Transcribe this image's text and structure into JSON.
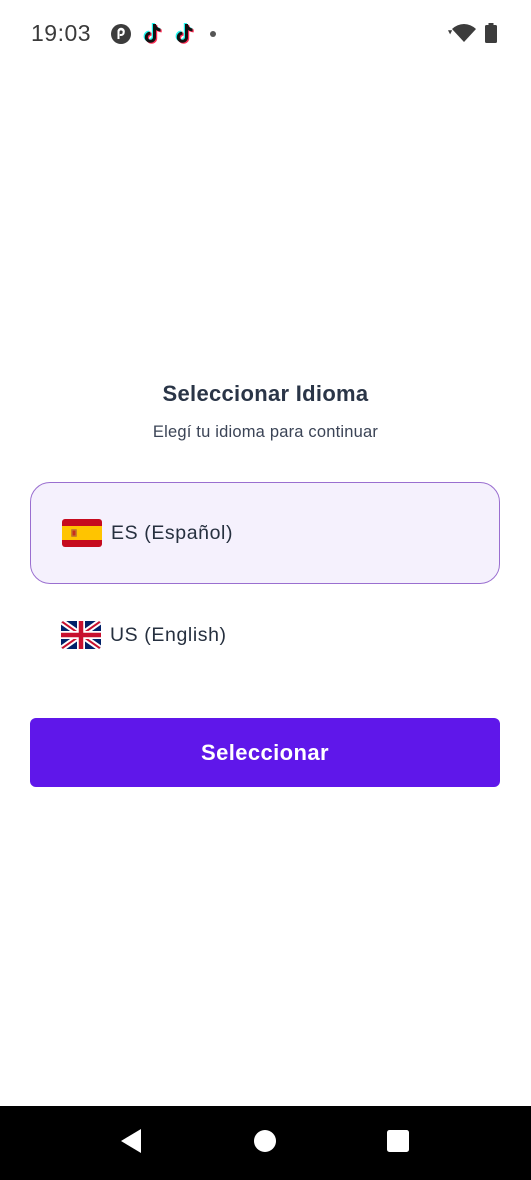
{
  "status_bar": {
    "time": "19:03",
    "notification_icons": [
      "pocketcasts-icon",
      "tiktok-icon",
      "tiktok-icon",
      "more-dot-icon"
    ],
    "system_icons": [
      "wifi-icon",
      "battery-icon"
    ]
  },
  "screen": {
    "title": "Seleccionar Idioma",
    "subtitle": "Elegí tu idioma para continuar",
    "languages": [
      {
        "flag": "spain-flag-icon",
        "label": "ES (Español)",
        "selected": true
      },
      {
        "flag": "uk-flag-icon",
        "label": "US (English)",
        "selected": false
      }
    ],
    "select_button_label": "Seleccionar"
  },
  "colors": {
    "accent": "#5f17ea",
    "selected_bg": "#f5f1fd",
    "selected_border": "#9a6fd0",
    "text": "#2a3547"
  },
  "nav_bar": {
    "buttons": [
      "back-icon",
      "home-icon",
      "recents-icon"
    ]
  }
}
